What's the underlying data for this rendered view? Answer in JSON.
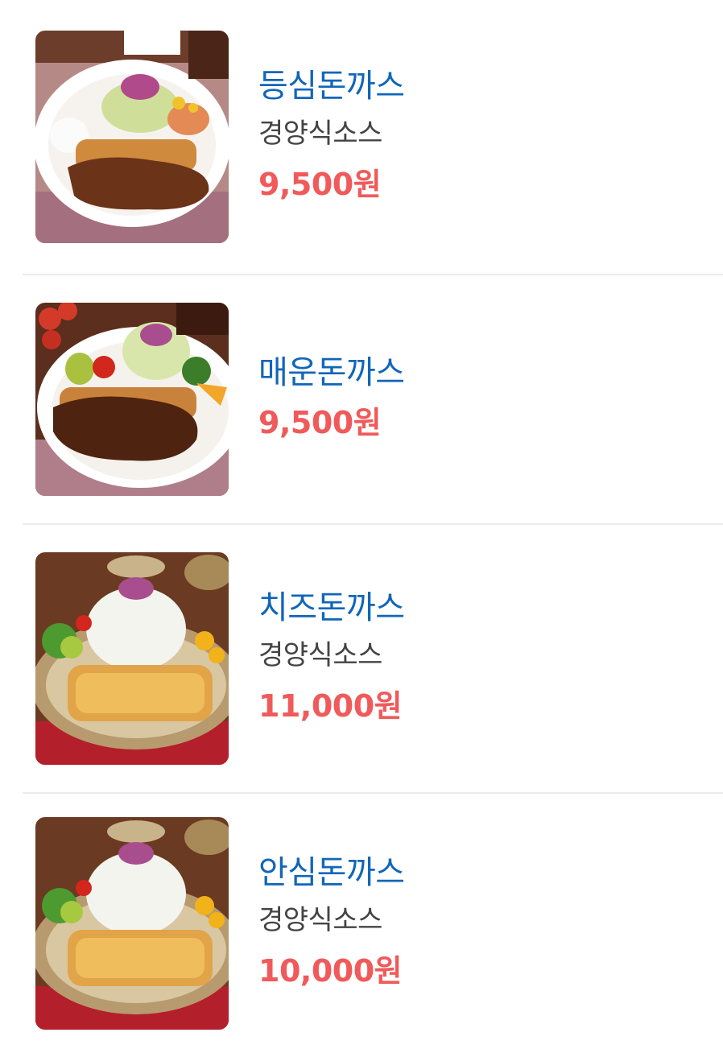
{
  "menu": {
    "items": [
      {
        "name": "등심돈까스",
        "description": "경양식소스",
        "price": "9,500원",
        "image": "katsu-sauce-photo"
      },
      {
        "name": "매운돈까스",
        "description": "",
        "price": "9,500원",
        "image": "spicy-katsu-photo"
      },
      {
        "name": "치즈돈까스",
        "description": "경양식소스",
        "price": "11,000원",
        "image": "cheese-katsu-photo"
      },
      {
        "name": "안심돈까스",
        "description": "경양식소스",
        "price": "10,000원",
        "image": "fillet-katsu-photo"
      }
    ]
  },
  "colors": {
    "name": "#1166b8",
    "description": "#444444",
    "price": "#f05a5a",
    "divider": "#ececec"
  }
}
